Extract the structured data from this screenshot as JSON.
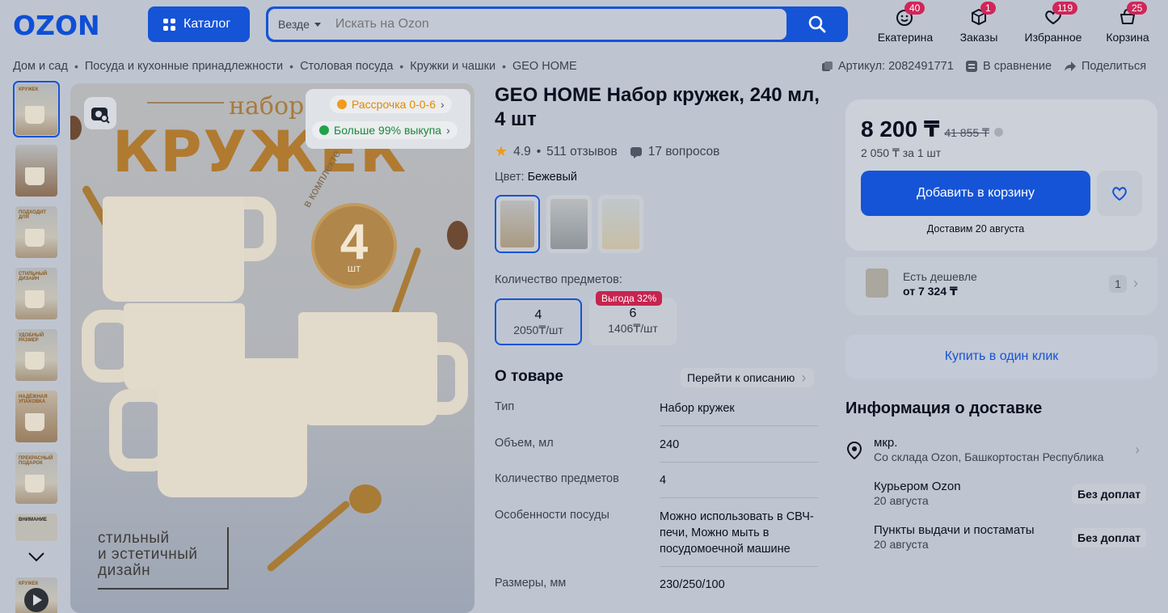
{
  "header": {
    "logo": "OZON",
    "catalog_label": "Каталог",
    "search_scope": "Везде",
    "search_placeholder": "Искать на Ozon",
    "nav": [
      {
        "label": "Екатерина",
        "badge": "40",
        "icon": "face-icon"
      },
      {
        "label": "Заказы",
        "badge": "1",
        "icon": "box-icon"
      },
      {
        "label": "Избранное",
        "badge": "119",
        "icon": "heart-icon"
      },
      {
        "label": "Корзина",
        "badge": "25",
        "icon": "cart-icon"
      }
    ]
  },
  "breadcrumbs": [
    "Дом и сад",
    "Посуда и кухонные принадлежности",
    "Столовая посуда",
    "Кружки и чашки",
    "GEO HOME"
  ],
  "meta": {
    "article": "Артикул: 2082491771",
    "compare": "В сравнение",
    "share": "Поделиться"
  },
  "hero": {
    "word_top": "набор",
    "word_main": "КРУЖЕК",
    "ring_text": "в комплекте",
    "count": "4",
    "count_unit": "шт",
    "caption": [
      "стильный",
      "и эстетичный",
      "дизайн"
    ],
    "promo_installment": "Рассрочка 0-0-6",
    "promo_buyout": "Больше 99% выкупа"
  },
  "thumbnails": [
    {
      "label": "КРУЖЕК"
    },
    {
      "label": ""
    },
    {
      "label": "ПОДХОДИТ ДЛЯ"
    },
    {
      "label": "СТИЛЬНЫЙ ДИЗАЙН"
    },
    {
      "label": "УДОБНЫЙ РАЗМЕР"
    },
    {
      "label": "НАДЁЖНАЯ УПАКОВКА"
    },
    {
      "label": "ПРЕКРАСНЫЙ ПОДАРОК"
    },
    {
      "label": "ВНИМАНИЕ"
    },
    {
      "label": "КРУЖЕК"
    }
  ],
  "product": {
    "title": "GEO HOME Набор кружек, 240 мл, 4 шт",
    "rating": "4.9",
    "reviews": "511 отзывов",
    "questions": "17 вопросов",
    "color_label": "Цвет:",
    "color_value": "Бежевый",
    "qty_label": "Количество предметов:",
    "options": [
      {
        "count": "4",
        "price": "2050₸/шт"
      },
      {
        "count": "6",
        "price": "1406₸/шт",
        "badge": "Выгода 32%"
      }
    ]
  },
  "about": {
    "title": "О товаре",
    "goto": "Перейти к описанию",
    "specs": [
      {
        "k": "Тип",
        "v": "Набор кружек"
      },
      {
        "k": "Объем, мл",
        "v": "240"
      },
      {
        "k": "Количество предметов",
        "v": "4"
      },
      {
        "k": "Особенности посуды",
        "v": "Можно использовать в СВЧ-печи, Можно мыть в посудомоечной машине"
      },
      {
        "k": "Размеры, мм",
        "v": "230/250/100"
      }
    ]
  },
  "buy": {
    "price": "8 200 ₸",
    "old_price": "41 855 ₸",
    "unit_price": "2 050 ₸ за 1 шт",
    "add_to_cart": "Добавить в корзину",
    "delivery": "Доставим 20 августа",
    "cheaper_label": "Есть дешевле",
    "cheaper_price": "от 7 324 ₸",
    "cheaper_count": "1",
    "one_click": "Купить в один клик"
  },
  "delivery_info": {
    "title": "Информация о доставке",
    "address": "мкр.",
    "warehouse": "Со склада Ozon, Башкортостан Республика",
    "methods": [
      {
        "name": "Курьером Ozon",
        "date": "20 августа",
        "tag": "Без доплат"
      },
      {
        "name": "Пункты выдачи и постаматы",
        "date": "20 августа",
        "tag": "Без доплат"
      }
    ]
  },
  "colors": {
    "accent": "#1554d6",
    "badge": "#d0265a",
    "star": "#e99b1c",
    "overlay_bg": "#bfc5d0"
  }
}
